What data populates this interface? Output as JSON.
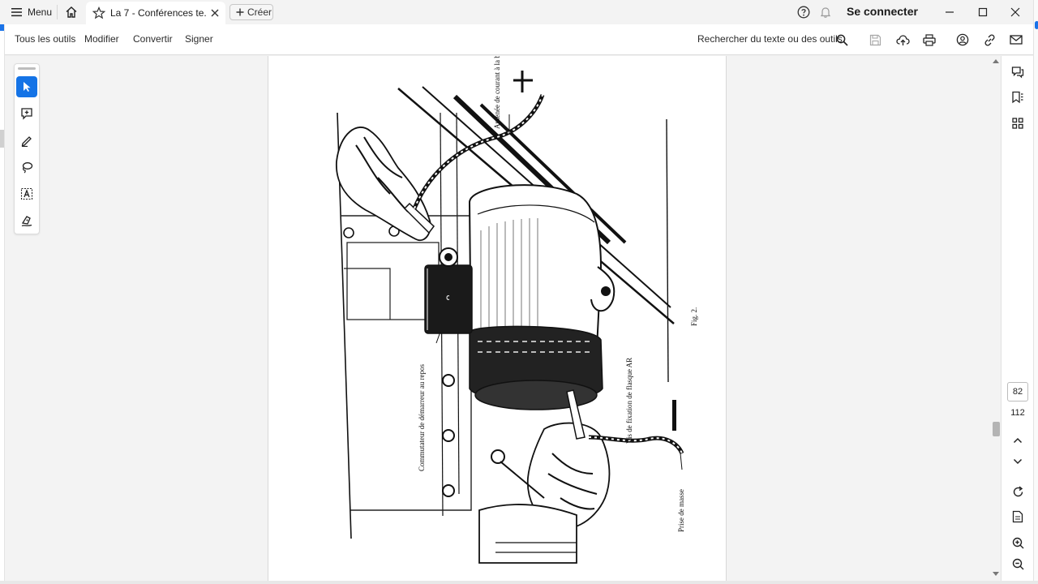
{
  "titlebar": {
    "menu_label": "Menu",
    "tab_title": "La 7 - Conférences te...",
    "create_label": "Créer",
    "signin_label": "Se connecter"
  },
  "toolbar": {
    "items": [
      "Tous les outils",
      "Modifier",
      "Convertir",
      "Signer"
    ],
    "search_label": "Rechercher du texte ou des outils"
  },
  "left_tools": [
    "select-icon",
    "comment-icon",
    "pen-icon",
    "lasso-icon",
    "text-box-icon",
    "sign-icon"
  ],
  "document": {
    "labels": {
      "top": "Amenée de courant à la borne du démarreur",
      "left": "Commutateur de démarreur au repos",
      "right_screw": "Vis de fixation de flasque AR",
      "right_ground": "Prise de masse",
      "figure": "Fig. 2."
    }
  },
  "page_nav": {
    "current": "82",
    "total": "112"
  },
  "colors": {
    "accent": "#1473e6",
    "page_bg": "#ffffff",
    "viewer_bg": "#f3f3f3"
  }
}
